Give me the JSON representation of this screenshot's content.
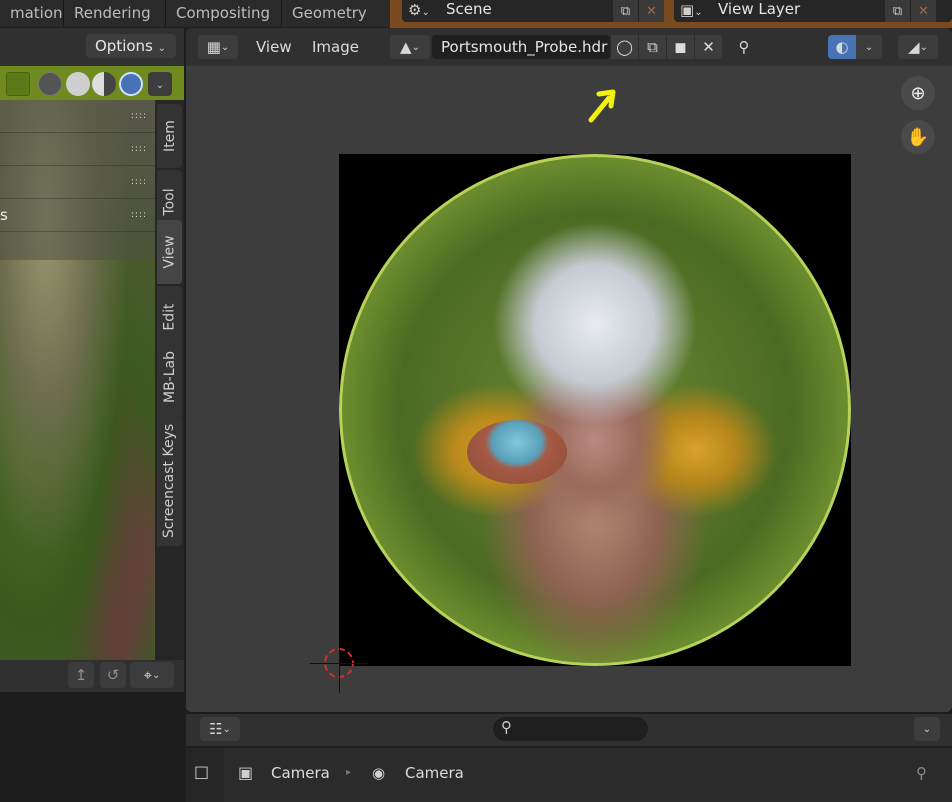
{
  "workspace_tabs": [
    "mation",
    "Rendering",
    "Compositing",
    "Geometry Nc"
  ],
  "scene": {
    "label": "Scene"
  },
  "view_layer": {
    "label": "View Layer"
  },
  "left_viewport": {
    "options_label": "Options",
    "side_tabs": [
      "Item",
      "Tool",
      "View",
      "Edit",
      "MB-Lab",
      "Screencast Keys"
    ],
    "panel_rows": [
      "",
      "",
      "",
      "s"
    ],
    "panel_row_handle": "::::"
  },
  "image_editor": {
    "menus": [
      "View",
      "Image"
    ],
    "image_name": "Portsmouth_Probe.hdr",
    "accent_color": "#4772b3",
    "annotation_color": "#f2f20e"
  },
  "bottom": {
    "search_placeholder": "",
    "breadcrumb": [
      "Camera",
      "Camera"
    ]
  },
  "icons": [
    "scene-icon",
    "view-layer-icon",
    "editor-type-icon",
    "image-browse-icon",
    "fake-user-shield-icon",
    "duplicate-icon",
    "folder-icon",
    "close-icon",
    "pin-icon",
    "overlay-icon",
    "display-channels-icon",
    "zoom-icon",
    "hand-pan-icon",
    "search-icon",
    "camera-object-icon",
    "camera-data-icon"
  ]
}
